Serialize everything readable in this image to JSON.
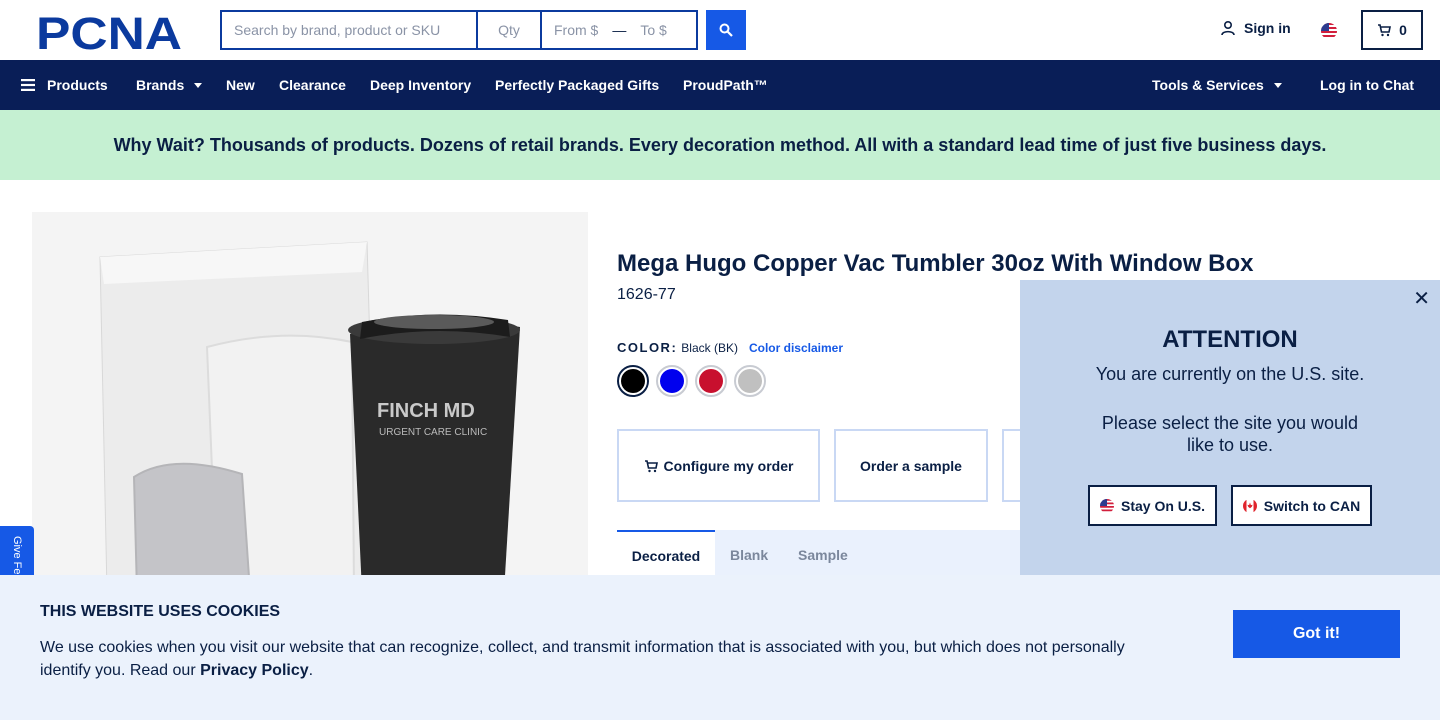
{
  "header": {
    "logo_text": "PCNA",
    "search_placeholder": "Search by brand, product or SKU",
    "qty_placeholder": "Qty",
    "from_placeholder": "From $",
    "range_dash": "—",
    "to_placeholder": "To $",
    "sign_in_label": "Sign in",
    "cart_count": "0"
  },
  "nav": {
    "products": "Products",
    "brands": "Brands",
    "new": "New",
    "clearance": "Clearance",
    "deep_inventory": "Deep Inventory",
    "gifts": "Perfectly Packaged Gifts",
    "proudpath": "ProudPath™",
    "tools": "Tools & Services",
    "chat": "Log in to Chat"
  },
  "banner": {
    "text": "Why Wait? Thousands of products. Dozens of retail brands. Every decoration method. All with a standard lead time of just five business days."
  },
  "product": {
    "image_brand_text": "FINCH MD",
    "image_sub_text": "URGENT CARE CLINIC",
    "title": "Mega Hugo Copper Vac Tumbler 30oz With Window Box",
    "sku": "1626-77",
    "color_label": "COLOR:",
    "color_value": "Black (BK)",
    "color_disclaimer": "Color disclaimer",
    "swatches": [
      "#000000",
      "#0000ee",
      "#c8102e",
      "#c0c0c0"
    ],
    "configure_label": "Configure my order",
    "sample_label": "Order a sample",
    "tabs": [
      "Decorated",
      "Blank",
      "Sample"
    ]
  },
  "feedback": {
    "label": "Give Feedback"
  },
  "popup": {
    "heading": "ATTENTION",
    "message1": "You are currently on the U.S. site.",
    "message2": "Please select the site you would like to use.",
    "stay_label": "Stay On U.S.",
    "switch_label": "Switch to CAN"
  },
  "cookie": {
    "title": "THIS WEBSITE USES COOKIES",
    "text": "We use cookies when you visit our website that can recognize, collect, and transmit information that is associated with you, but which does not personally identify you. Read our",
    "policy_link": "Privacy Policy",
    "period": ".",
    "button_label": "Got it!"
  },
  "colors": {
    "brand_navy": "#091e57",
    "accent_blue": "#1659e6",
    "banner_green": "#c5f0d2",
    "popup_blue": "#c3d4ec"
  }
}
